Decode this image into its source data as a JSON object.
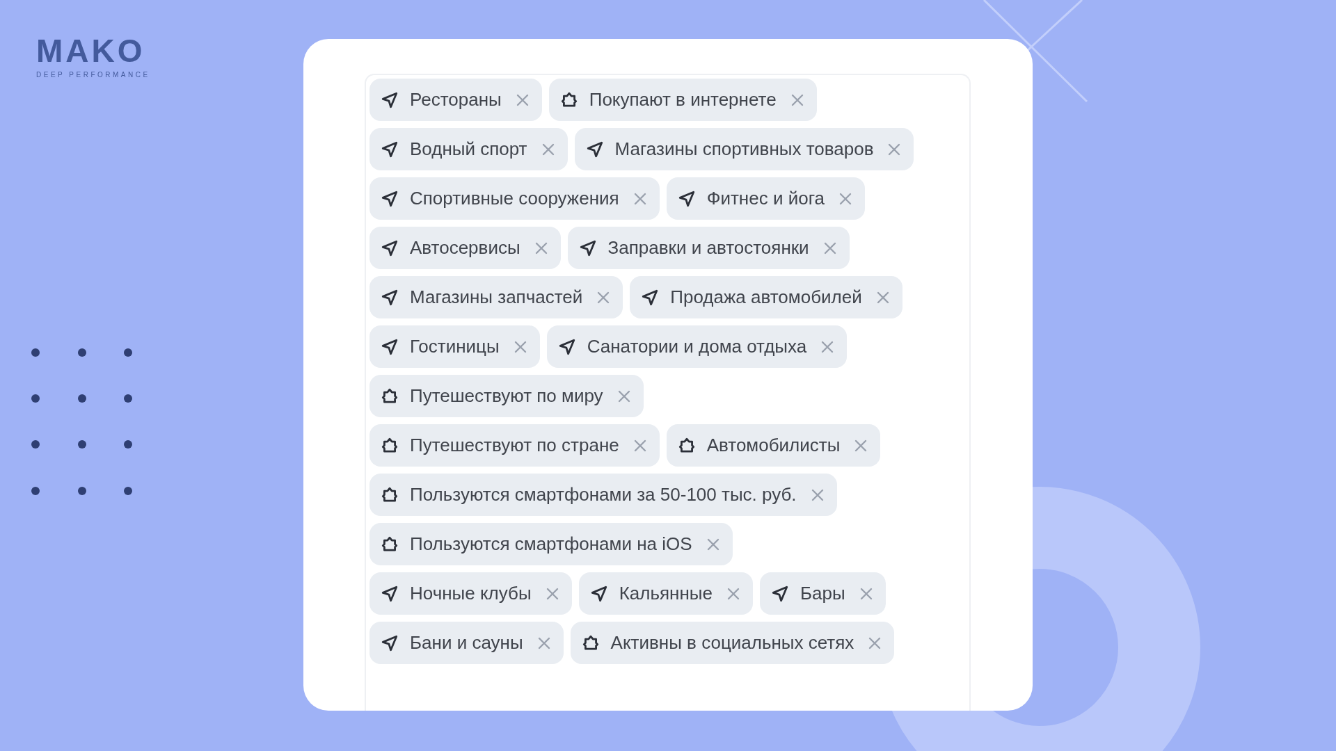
{
  "logo": {
    "name": "MAKO",
    "tagline": "DEEP PERFORMANCE"
  },
  "tag_rows": [
    [
      {
        "label": "Рестораны",
        "kind": "place"
      },
      {
        "label": "Покупают в интернете",
        "kind": "segment"
      }
    ],
    [
      {
        "label": "Водный спорт",
        "kind": "place"
      },
      {
        "label": "Магазины спортивных товаров",
        "kind": "place"
      }
    ],
    [
      {
        "label": "Спортивные сооружения",
        "kind": "place"
      },
      {
        "label": "Фитнес и йога",
        "kind": "place"
      }
    ],
    [
      {
        "label": "Автосервисы",
        "kind": "place"
      },
      {
        "label": "Заправки и автостоянки",
        "kind": "place"
      }
    ],
    [
      {
        "label": "Магазины запчастей",
        "kind": "place"
      },
      {
        "label": "Продажа автомобилей",
        "kind": "place"
      }
    ],
    [
      {
        "label": "Гостиницы",
        "kind": "place"
      },
      {
        "label": "Санатории и дома отдыха",
        "kind": "place"
      }
    ],
    [
      {
        "label": "Путешествуют по миру",
        "kind": "segment"
      }
    ],
    [
      {
        "label": "Путешествуют по стране",
        "kind": "segment"
      },
      {
        "label": "Автомобилисты",
        "kind": "segment"
      }
    ],
    [
      {
        "label": "Пользуются смартфонами за 50-100 тыс. руб.",
        "kind": "segment"
      }
    ],
    [
      {
        "label": "Пользуются смартфонами на iOS",
        "kind": "segment"
      }
    ],
    [
      {
        "label": "Ночные клубы",
        "kind": "place"
      },
      {
        "label": "Кальянные",
        "kind": "place"
      },
      {
        "label": "Бары",
        "kind": "place"
      }
    ],
    [
      {
        "label": "Бани и сауны",
        "kind": "place"
      },
      {
        "label": "Активны в социальных сетях",
        "kind": "segment"
      }
    ]
  ]
}
